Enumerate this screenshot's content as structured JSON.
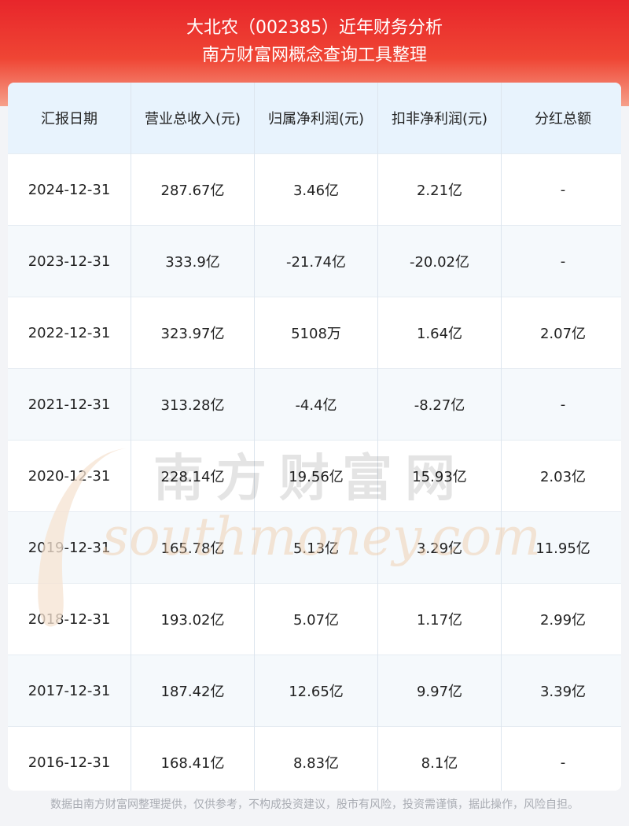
{
  "header": {
    "title_line1": "大北农（002385）近年财务分析",
    "title_line2": "南方财富网概念查询工具整理"
  },
  "table": {
    "columns": [
      "汇报日期",
      "营业总收入(元)",
      "归属净利润(元)",
      "扣非净利润(元)",
      "分红总额"
    ],
    "rows": [
      [
        "2024-12-31",
        "287.67亿",
        "3.46亿",
        "2.21亿",
        "-"
      ],
      [
        "2023-12-31",
        "333.9亿",
        "-21.74亿",
        "-20.02亿",
        "-"
      ],
      [
        "2022-12-31",
        "323.97亿",
        "5108万",
        "1.64亿",
        "2.07亿"
      ],
      [
        "2021-12-31",
        "313.28亿",
        "-4.4亿",
        "-8.27亿",
        "-"
      ],
      [
        "2020-12-31",
        "228.14亿",
        "19.56亿",
        "15.93亿",
        "2.03亿"
      ],
      [
        "2019-12-31",
        "165.78亿",
        "5.13亿",
        "3.29亿",
        "11.95亿"
      ],
      [
        "2018-12-31",
        "193.02亿",
        "5.07亿",
        "1.17亿",
        "2.99亿"
      ],
      [
        "2017-12-31",
        "187.42亿",
        "12.65亿",
        "9.97亿",
        "3.39亿"
      ],
      [
        "2016-12-31",
        "168.41亿",
        "8.83亿",
        "8.1亿",
        "-"
      ]
    ]
  },
  "watermark": {
    "cn": "南方财富网",
    "en": "southmoney.com"
  },
  "footer": {
    "disclaimer": "数据由南方财富网整理提供，仅供参考，不构成投资建议，股市有风险，投资需谨慎，据此操作，风险自担。"
  },
  "colors": {
    "header_red": "#e8262b",
    "header_bg_light": "#e8f3fd",
    "row_alt": "#f5f9fc",
    "watermark": "#f0c9a4"
  }
}
